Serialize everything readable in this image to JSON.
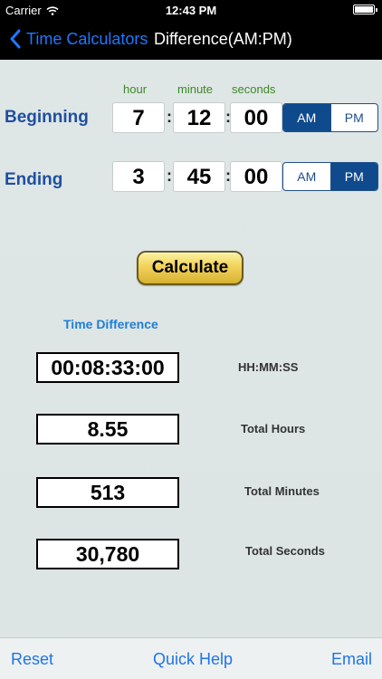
{
  "status_bar": {
    "carrier": "Carrier",
    "time": "12:43 PM"
  },
  "nav": {
    "back_label": "Time Calculators",
    "title": "Difference(AM:PM)"
  },
  "columns": {
    "hour": "hour",
    "minute": "minute",
    "seconds": "seconds"
  },
  "beginning": {
    "label": "Beginning",
    "hour": "7",
    "minute": "12",
    "seconds": "00",
    "am": "AM",
    "pm": "PM",
    "selected": "AM"
  },
  "ending": {
    "label": "Ending",
    "hour": "3",
    "minute": "45",
    "seconds": "00",
    "am": "AM",
    "pm": "PM",
    "selected": "PM"
  },
  "calculate_label": "Calculate",
  "results": {
    "title": "Time Difference",
    "hhmmss": {
      "value": "00:08:33:00",
      "label": "HH:MM:SS"
    },
    "hours": {
      "value": "8.55",
      "label": "Total Hours"
    },
    "minutes": {
      "value": "513",
      "label": "Total Minutes"
    },
    "seconds": {
      "value": "30,780",
      "label": "Total Seconds"
    }
  },
  "toolbar": {
    "reset": "Reset",
    "help": "Quick Help",
    "email": "Email"
  },
  "colors": {
    "accent": "#1e74e8",
    "label_blue": "#1f4fa0",
    "selected_segment": "#0f4a8c",
    "column_green": "#3a8a25"
  }
}
